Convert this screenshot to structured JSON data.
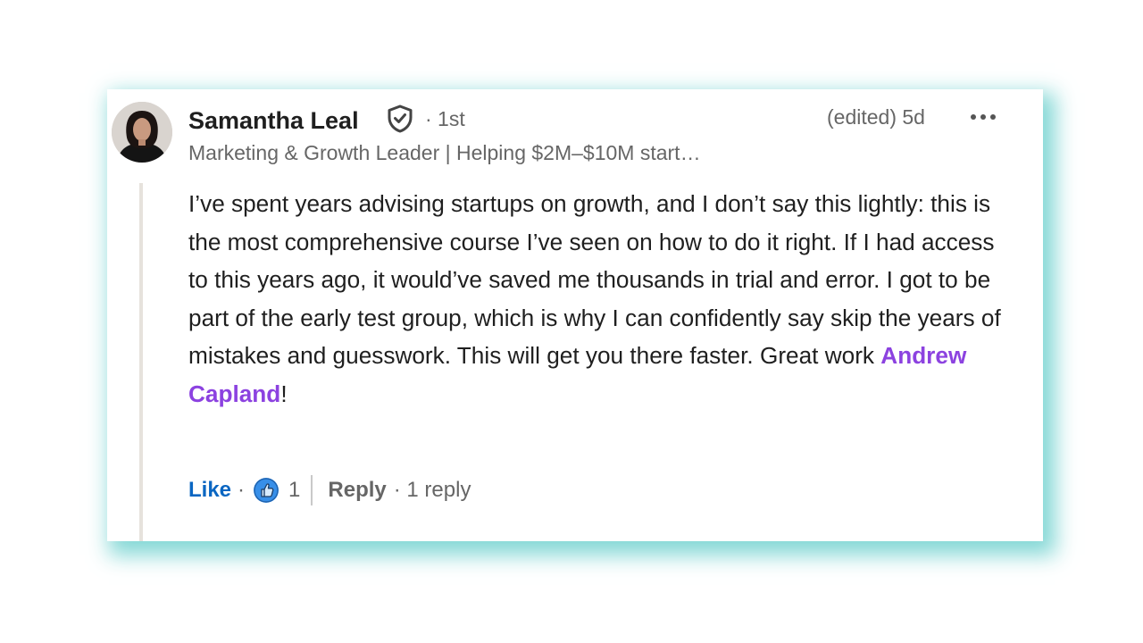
{
  "comment": {
    "author_name": "Samantha Leal",
    "author_degree": "· 1st",
    "author_headline": "Marketing & Growth Leader | Helping $2M–$10M start…",
    "edited_label": "(edited) 5d",
    "body_text": "I’ve spent years advising startups on growth, and I don’t say this lightly: this is the most comprehensive course I’ve seen on how to do it right. If I had access to this years ago, it would’ve saved me thousands in trial and error. I got to be part of the early test group, which is why I can confidently say skip the years of mistakes and guesswork. This will get you there faster. Great work ",
    "mention_name": "Andrew Capland",
    "body_end": "!"
  },
  "actions": {
    "like_label": "Like",
    "separator": "·",
    "reaction_count": "1",
    "reply_label": "Reply",
    "reply_count_label": "· 1 reply"
  },
  "icons": {
    "verified": "verified-shield-icon",
    "more": "more-options-icon",
    "reaction": "like-reaction-icon"
  },
  "colors": {
    "card_shadow": "#7ed6d4",
    "like_blue": "#0a66c2",
    "mention_purple": "#8c42e0",
    "text_primary": "#1f1f1f",
    "text_secondary": "#666666"
  }
}
